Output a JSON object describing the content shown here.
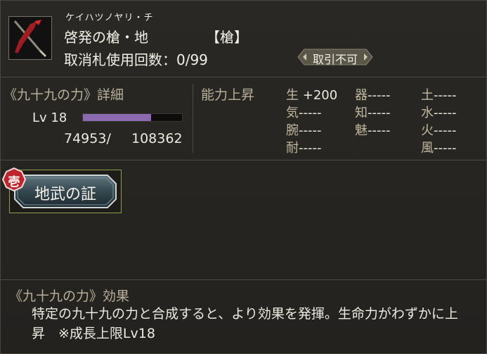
{
  "item": {
    "ruby": "ケイハツノヤリ・チ",
    "name": "啓発の槍・地",
    "type": "【槍】",
    "usage": "取消札使用回数：0/99",
    "badge": "取引不可",
    "icon": "spear-icon"
  },
  "details": {
    "title": "《九十九の力》詳細",
    "level": "Lv 18",
    "exp_current": "74953/",
    "exp_max": "108362",
    "exp_progress": 0.69
  },
  "ability": {
    "title": "能力上昇",
    "stats": [
      {
        "label": "生",
        "value": "+200"
      },
      {
        "label": "器",
        "value": "-----"
      },
      {
        "label": "土",
        "value": "-----"
      },
      {
        "label": "気",
        "value": "-----"
      },
      {
        "label": "知",
        "value": "-----"
      },
      {
        "label": "水",
        "value": "-----"
      },
      {
        "label": "腕",
        "value": "-----"
      },
      {
        "label": "魅",
        "value": "-----"
      },
      {
        "label": "火",
        "value": "-----"
      },
      {
        "label": "耐",
        "value": "-----"
      },
      {
        "label": "風",
        "value": "-----"
      }
    ]
  },
  "skill": {
    "rank": "壱",
    "name": "地武の証"
  },
  "effect": {
    "title": "《九十九の力》効果",
    "text": "特定の九十九の力と合成すると、より効果を発揮。生命力がわずかに上昇　※成長上限Lv18"
  },
  "colors": {
    "background": "#262420",
    "label": "#b8b09a",
    "text": "#eeeae0",
    "exp_bar": "#8b69b1",
    "skill_border": "#8fa04a",
    "rank_badge": "#c0242a"
  }
}
